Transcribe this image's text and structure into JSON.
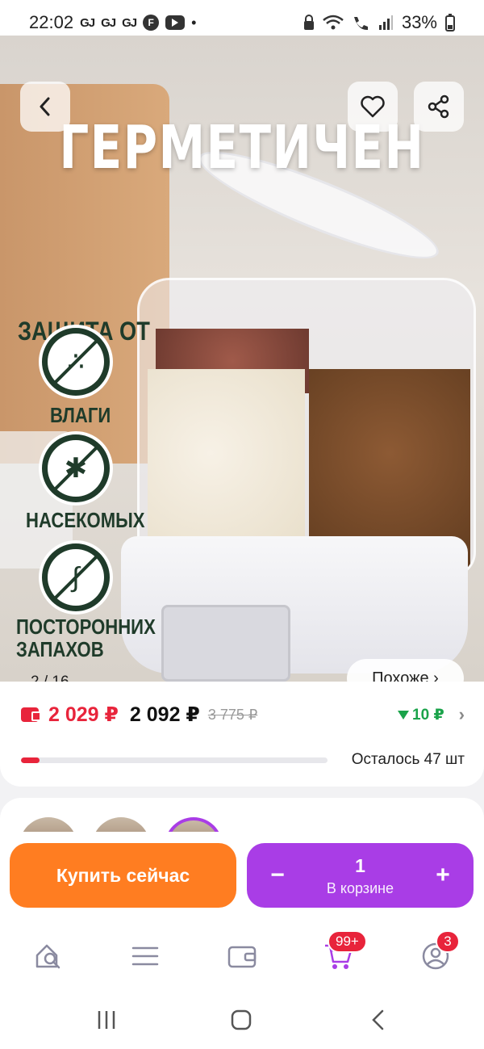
{
  "status_bar": {
    "time": "22:02",
    "notif_badges": [
      "GJ",
      "GJ",
      "GJ"
    ],
    "round_badge": "F",
    "dot": "•",
    "battery": "33%",
    "icons": [
      "lock-icon",
      "wifi-icon",
      "wifi-call-icon",
      "signal-icon",
      "battery-icon",
      "youtube-icon"
    ]
  },
  "gallery": {
    "headline": "ГЕРМЕТИЧЕН",
    "protect_title": "ЗАЩИТА ОТ",
    "badges": [
      {
        "label": "ВЛАГИ",
        "icon": "drops-icon"
      },
      {
        "label": "НАСЕКОМЫХ",
        "icon": "insect-icon"
      },
      {
        "label": "ПОСТОРОННИХ ЗАПАХОВ",
        "icon": "nose-icon"
      }
    ],
    "counter": "2 / 16",
    "similar_label": "Похоже ›"
  },
  "price": {
    "main": "2 029 ₽",
    "secondary": "2 092 ₽",
    "old": "3 775 ₽",
    "points": "10 ₽",
    "points_color": "#1aa34a",
    "accent_red": "#e8243b"
  },
  "stock": {
    "text": "Осталось 47 шт",
    "fill_fraction": 0.06
  },
  "actions": {
    "buy_now": "Купить сейчас",
    "qty": "1",
    "in_cart": "В корзине",
    "minus": "−",
    "plus": "+",
    "buy_color": "#ff7d21",
    "cart_color": "#a93de6"
  },
  "bottom_nav": {
    "cart_badge": "99+",
    "profile_badge": "3",
    "items": [
      "home-search-icon",
      "catalog-icon",
      "wallet-icon",
      "cart-icon",
      "profile-icon"
    ]
  }
}
